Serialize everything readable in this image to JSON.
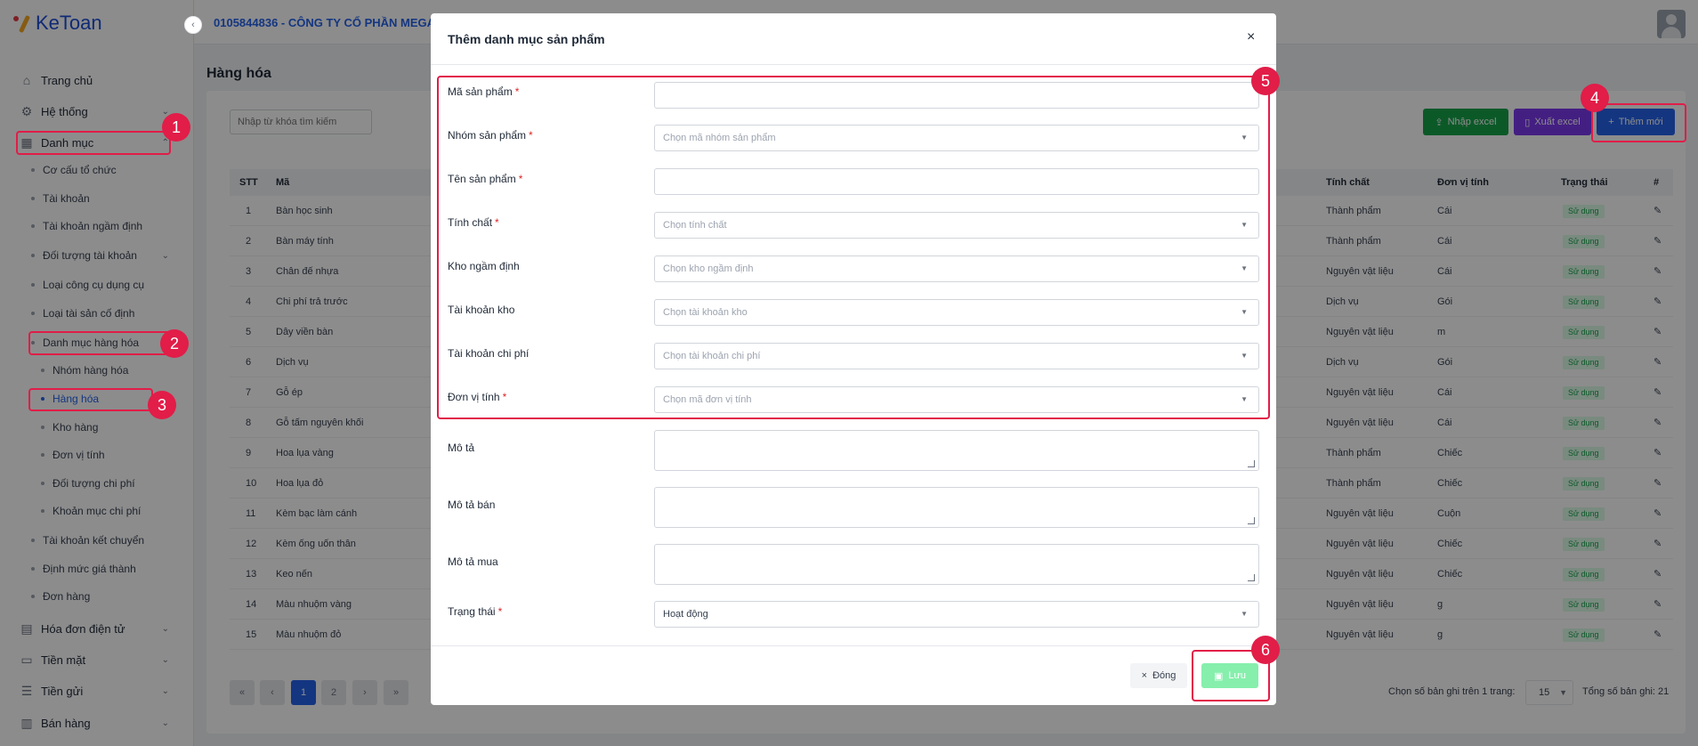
{
  "app": {
    "logo": "KeToan",
    "company": "0105844836 - CÔNG TY CỔ PHẦN MEGA"
  },
  "sidebar": {
    "items": [
      {
        "label": "Trang chủ",
        "icon": "home-icon"
      },
      {
        "label": "Hệ thống",
        "icon": "gear-icon"
      },
      {
        "label": "Danh mục",
        "icon": "grid-icon"
      },
      {
        "label": "Cơ cấu tổ chức"
      },
      {
        "label": "Tài khoản"
      },
      {
        "label": "Tài khoản ngầm định"
      },
      {
        "label": "Đối tượng tài khoản"
      },
      {
        "label": "Loại công cụ dụng cụ"
      },
      {
        "label": "Loại tài sản cố định"
      },
      {
        "label": "Danh mục hàng hóa"
      },
      {
        "label": "Nhóm hàng hóa"
      },
      {
        "label": "Hàng hóa"
      },
      {
        "label": "Kho hàng"
      },
      {
        "label": "Đơn vị tính"
      },
      {
        "label": "Đối tượng chi phí"
      },
      {
        "label": "Khoản mục chi phí"
      },
      {
        "label": "Tài khoản kết chuyển"
      },
      {
        "label": "Định mức giá thành"
      },
      {
        "label": "Đơn hàng"
      },
      {
        "label": "Hóa đơn điện tử",
        "icon": "receipt-icon"
      },
      {
        "label": "Tiền mặt",
        "icon": "cash-icon"
      },
      {
        "label": "Tiền gửi",
        "icon": "bank-icon"
      },
      {
        "label": "Bán hàng",
        "icon": "cart-icon"
      }
    ]
  },
  "main": {
    "title": "Hàng hóa",
    "search_placeholder": "Nhập từ khóa tìm kiếm",
    "btn_import": "Nhập excel",
    "btn_export": "Xuất excel",
    "btn_add": "Thêm mới",
    "columns": [
      "STT",
      "Mã",
      "Tính chất",
      "Đơn vị tính",
      "Trạng thái",
      "#"
    ],
    "rows": [
      {
        "stt": "1",
        "ma": "Bàn học sinh",
        "tc": "Thành phẩm",
        "dvt": "Cái",
        "tt": "Sử dụng"
      },
      {
        "stt": "2",
        "ma": "Bàn máy tính",
        "tc": "Thành phẩm",
        "dvt": "Cái",
        "tt": "Sử dụng"
      },
      {
        "stt": "3",
        "ma": "Chân đế nhựa",
        "tc": "Nguyên vật liệu",
        "dvt": "Cái",
        "tt": "Sử dụng"
      },
      {
        "stt": "4",
        "ma": "Chi phí trả trước",
        "tc": "Dịch vụ",
        "dvt": "Gói",
        "tt": "Sử dụng"
      },
      {
        "stt": "5",
        "ma": "Dây viền bàn",
        "tc": "Nguyên vật liệu",
        "dvt": "m",
        "tt": "Sử dụng"
      },
      {
        "stt": "6",
        "ma": "Dịch vụ",
        "tc": "Dịch vụ",
        "dvt": "Gói",
        "tt": "Sử dụng"
      },
      {
        "stt": "7",
        "ma": "Gỗ ép",
        "tc": "Nguyên vật liệu",
        "dvt": "Cái",
        "tt": "Sử dụng"
      },
      {
        "stt": "8",
        "ma": "Gỗ tấm nguyên khối",
        "tc": "Nguyên vật liệu",
        "dvt": "Cái",
        "tt": "Sử dụng"
      },
      {
        "stt": "9",
        "ma": "Hoa lụa vàng",
        "tc": "Thành phẩm",
        "dvt": "Chiếc",
        "tt": "Sử dụng"
      },
      {
        "stt": "10",
        "ma": "Hoa lụa đỏ",
        "tc": "Thành phẩm",
        "dvt": "Chiếc",
        "tt": "Sử dụng"
      },
      {
        "stt": "11",
        "ma": "Kèm bạc làm cánh",
        "tc": "Nguyên vật liệu",
        "dvt": "Cuộn",
        "tt": "Sử dụng"
      },
      {
        "stt": "12",
        "ma": "Kèm ống uốn thân",
        "tc": "Nguyên vật liệu",
        "dvt": "Chiếc",
        "tt": "Sử dụng"
      },
      {
        "stt": "13",
        "ma": "Keo nến",
        "tc": "Nguyên vật liệu",
        "dvt": "Chiếc",
        "tt": "Sử dụng"
      },
      {
        "stt": "14",
        "ma": "Màu nhuộm vàng",
        "tc": "Nguyên vật liệu",
        "dvt": "g",
        "tt": "Sử dụng"
      },
      {
        "stt": "15",
        "ma": "Màu nhuộm đỏ",
        "tc": "Nguyên vật liệu",
        "dvt": "g",
        "tt": "Sử dụng"
      }
    ],
    "pages": [
      "1",
      "2"
    ],
    "per_page_label": "Chọn số bản ghi trên 1 trang:",
    "per_page": "15",
    "total_label": "Tổng số bản ghi: 21"
  },
  "modal": {
    "title": "Thêm danh mục sản phẩm",
    "fields": [
      {
        "label": "Mã sản phẩm",
        "req": "*",
        "placeholder": ""
      },
      {
        "label": "Nhóm sản phẩm",
        "req": "*",
        "placeholder": "Chọn mã nhóm sản phẩm"
      },
      {
        "label": "Tên sản phẩm",
        "req": "*",
        "placeholder": ""
      },
      {
        "label": "Tính chất",
        "req": "*",
        "placeholder": "Chọn tính chất"
      },
      {
        "label": "Kho ngầm định",
        "req": "",
        "placeholder": "Chọn kho ngầm định"
      },
      {
        "label": "Tài khoản kho",
        "req": "",
        "placeholder": "Chọn tài khoản kho"
      },
      {
        "label": "Tài khoản chi phí",
        "req": "",
        "placeholder": "Chọn tài khoản chi phí"
      },
      {
        "label": "Đơn vị tính",
        "req": "*",
        "placeholder": "Chọn mã đơn vị tính"
      }
    ],
    "textareas": [
      {
        "label": "Mô tả"
      },
      {
        "label": "Mô tả bán"
      },
      {
        "label": "Mô tả mua"
      }
    ],
    "status": {
      "label": "Trạng thái",
      "req": "*",
      "value": "Hoạt động"
    },
    "btn_close": "Đóng",
    "btn_save": "Lưu"
  },
  "markers": [
    "1",
    "2",
    "3",
    "4",
    "5",
    "6"
  ],
  "colors": {
    "primary": "#2563eb",
    "highlight": "#e11d48",
    "success": "#16a34a",
    "purple": "#7c3aed"
  }
}
